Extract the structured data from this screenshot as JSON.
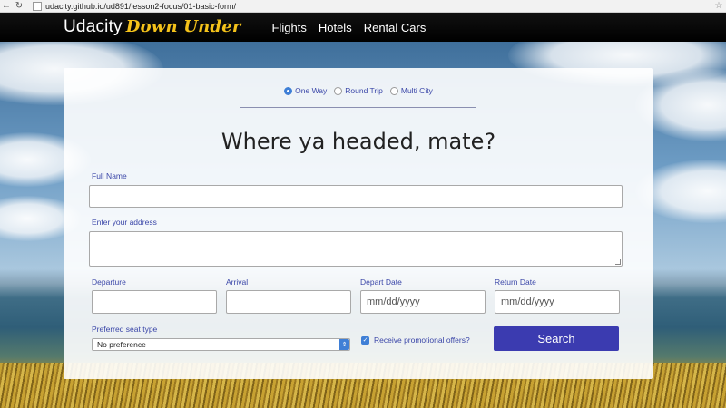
{
  "browser": {
    "url": "udacity.github.io/ud891/lesson2-focus/01-basic-form/",
    "back_icon": "←",
    "reload_icon": "↻",
    "star_icon": "☆"
  },
  "header": {
    "brand": "Udacity",
    "brand_accent": "Down Under",
    "nav": [
      "Flights",
      "Hotels",
      "Rental Cars"
    ],
    "accent_color": "#f4c21a"
  },
  "form": {
    "trip_types": [
      {
        "label": "One Way",
        "selected": true
      },
      {
        "label": "Round Trip",
        "selected": false
      },
      {
        "label": "Multi City",
        "selected": false
      }
    ],
    "heading": "Where ya headed, mate?",
    "full_name_label": "Full Name",
    "full_name_value": "",
    "address_label": "Enter your address",
    "address_value": "",
    "departure_label": "Departure",
    "arrival_label": "Arrival",
    "depart_date_label": "Depart Date",
    "depart_date_placeholder": "mm/dd/yyyy",
    "return_date_label": "Return Date",
    "return_date_placeholder": "mm/dd/yyyy",
    "seat_label": "Preferred seat type",
    "seat_value": "No preference",
    "promo_label": "Receive promotional offers?",
    "promo_checked": true,
    "search_label": "Search",
    "button_color": "#3b3bb0",
    "label_color": "#3a46a8"
  }
}
